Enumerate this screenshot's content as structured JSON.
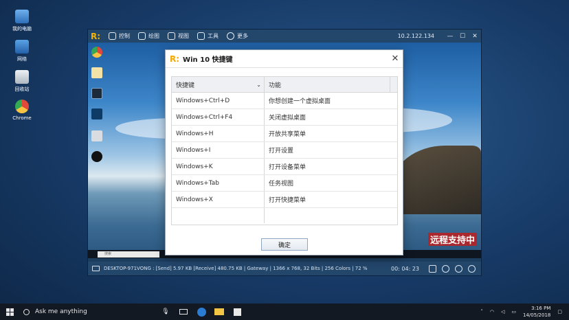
{
  "desktop": {
    "icons": [
      {
        "label": "我的电脑",
        "icon": "computer-icon",
        "color": "#4a90d9"
      },
      {
        "label": "网络",
        "icon": "network-icon",
        "color": "#3a7fc4"
      },
      {
        "label": "回收站",
        "icon": "recycle-bin-icon",
        "color": "#c9d2db"
      },
      {
        "label": "Chrome",
        "icon": "chrome-icon",
        "color": "#e0483a"
      }
    ]
  },
  "remote_window": {
    "toolbar": {
      "items": [
        {
          "label": "控制",
          "icon": "control-icon"
        },
        {
          "label": "绘图",
          "icon": "pen-icon"
        },
        {
          "label": "视图",
          "icon": "monitor-icon"
        },
        {
          "label": "工具",
          "icon": "tools-icon"
        },
        {
          "label": "更多",
          "icon": "gear-icon"
        }
      ],
      "ip": "10.2.122.134"
    },
    "watermark": "远程支持中",
    "remote_search_placeholder": "搜索",
    "status": {
      "text": "DESKTOP-971VONG : [Send] 5.97 KB  [Receive] 480.75 KB | Gateway | 1366 x 768, 32 Bits | 256 Colors | 72 %",
      "timer": "00: 04: 23"
    }
  },
  "dialog": {
    "title": "Win 10 快捷键",
    "columns": [
      "快捷键",
      "功能"
    ],
    "rows": [
      {
        "key": "Windows+Ctrl+D",
        "desc": "你想创建一个虚拟桌面"
      },
      {
        "key": "Windows+Ctrl+F4",
        "desc": "关闭虚拟桌面"
      },
      {
        "key": "Windows+H",
        "desc": "开放共享菜单"
      },
      {
        "key": "Windows+I",
        "desc": "打开设置"
      },
      {
        "key": "Windows+K",
        "desc": "打开设备菜单"
      },
      {
        "key": "Windows+Tab",
        "desc": "任务视图"
      },
      {
        "key": "Windows+X",
        "desc": "打开快捷菜单"
      }
    ],
    "ok_label": "确定"
  },
  "taskbar": {
    "search_placeholder": "Ask me anything",
    "time": "3:16 PM",
    "date": "14/05/2018"
  }
}
